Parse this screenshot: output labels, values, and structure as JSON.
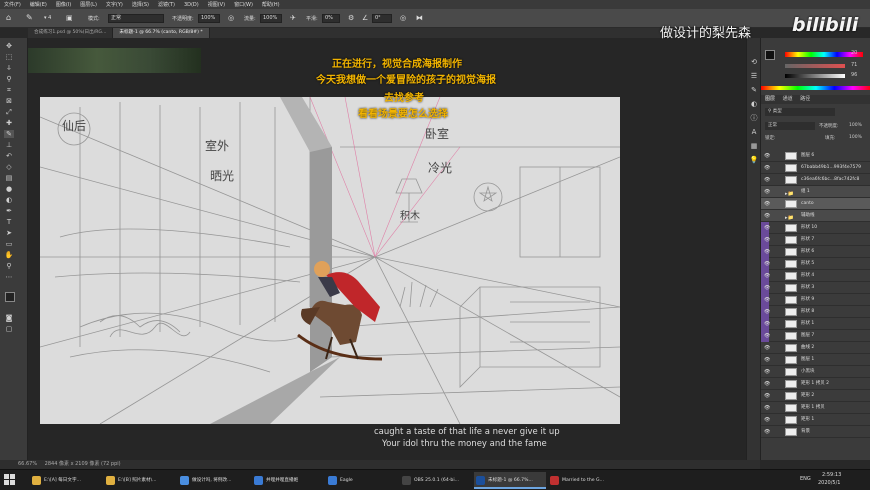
{
  "menubar": {
    "items": [
      "文件(F)",
      "编辑(E)",
      "图像(I)",
      "图层(L)",
      "文字(Y)",
      "选择(S)",
      "滤镜(T)",
      "3D(D)",
      "视图(V)",
      "窗口(W)",
      "帮助(H)"
    ]
  },
  "options_bar": {
    "mode_label": "模式:",
    "mode_value": "正常",
    "opacity_label": "不透明度:",
    "opacity_value": "100%",
    "flow_label": "流量:",
    "flow_value": "100%",
    "smoothing_label": "平滑:",
    "smoothing_value": "0%",
    "angle_value": "0°"
  },
  "doc_tabs": [
    {
      "label": "合成练习1.psd @ 50%(日出/RG...",
      "active": false
    },
    {
      "label": "未标题-1 @ 66.7% (canto, RGB/8#) *",
      "active": true
    }
  ],
  "overlay_text": {
    "line1": "正在进行，视觉合成海报制作",
    "line2": "今天我想做一个爱冒险的孩子的视觉海报",
    "line3": "去找参考",
    "line4": "看看场景要怎么选择"
  },
  "sketch_labels": {
    "outdoor": "室外",
    "sunshine": "晒光",
    "bedroom": "卧室",
    "cold_light": "冷光",
    "blocks": "积木",
    "corner": "仙后"
  },
  "subtitles": {
    "english": "caught a taste of that life a never give it up",
    "english2": "Your idol thru the money and the fame"
  },
  "watermark": {
    "text": "做设计的梨先森",
    "brand": "bilibili"
  },
  "color_panel": {
    "rows": [
      {
        "label": "H",
        "value": "20",
        "color": "#e05050"
      },
      {
        "label": "S",
        "value": "71",
        "color": "#50b050"
      },
      {
        "label": "B",
        "value": "96",
        "color": "#5070e0"
      }
    ]
  },
  "layers_panel": {
    "tabs": [
      "图层",
      "通道",
      "路径"
    ],
    "blend_mode": "正常",
    "opacity_label": "不透明度:",
    "opacity_value": "100%",
    "fill_label": "填充:",
    "fill_value": "100%",
    "lock_label": "锁定:",
    "layers": [
      {
        "name": "图层 6",
        "type": "normal"
      },
      {
        "name": "67babb49b1...993f4e7579",
        "type": "normal"
      },
      {
        "name": "c36ea6fc6bc...8fac742fc8",
        "type": "normal"
      },
      {
        "name": "组 1",
        "type": "group"
      },
      {
        "name": "canto",
        "type": "selected"
      },
      {
        "name": "辅助线",
        "type": "group"
      },
      {
        "name": "形状 10",
        "type": "purple"
      },
      {
        "name": "形状 7",
        "type": "purple"
      },
      {
        "name": "形状 6",
        "type": "purple"
      },
      {
        "name": "形状 5",
        "type": "purple"
      },
      {
        "name": "形状 4",
        "type": "purple"
      },
      {
        "name": "形状 3",
        "type": "purple"
      },
      {
        "name": "形状 9",
        "type": "purple"
      },
      {
        "name": "形状 8",
        "type": "purple"
      },
      {
        "name": "形状 1",
        "type": "purple"
      },
      {
        "name": "图层 7",
        "type": "purple"
      },
      {
        "name": "曲线 2",
        "type": "normal"
      },
      {
        "name": "图层 1",
        "type": "normal"
      },
      {
        "name": "小黑块",
        "type": "normal"
      },
      {
        "name": "矩形 1 拷贝 2",
        "type": "normal"
      },
      {
        "name": "矩形 2",
        "type": "normal"
      },
      {
        "name": "矩形 1 拷贝",
        "type": "normal"
      },
      {
        "name": "矩形 1",
        "type": "normal"
      },
      {
        "name": "背景",
        "type": "normal"
      }
    ]
  },
  "status_bar": {
    "zoom": "66.67%",
    "doc_size": "2844 像素 x 2109 像素 (72 ppi)"
  },
  "taskbar": {
    "items": [
      {
        "label": "E:\\[A] 每日文字...",
        "color": "#e0b040"
      },
      {
        "label": "E:\\[B] 照片素材\\...",
        "color": "#e0b040"
      },
      {
        "label": "做设计吗, 将例改...",
        "color": "#4a8ee0"
      },
      {
        "label": "并哩并哩直播姬",
        "color": "#3a7bd5"
      },
      {
        "label": "Eagle",
        "color": "#3a7bd5"
      },
      {
        "label": "OBS 25.0.1 (64-bi...",
        "color": "#444"
      },
      {
        "label": "未标题-1 @ 66.7%...",
        "color": "#1b4f9b"
      },
      {
        "label": "Married to the G...",
        "color": "#c03030"
      }
    ],
    "lang": "ENG",
    "time": "2:59:13",
    "date": "2020/5/1"
  }
}
